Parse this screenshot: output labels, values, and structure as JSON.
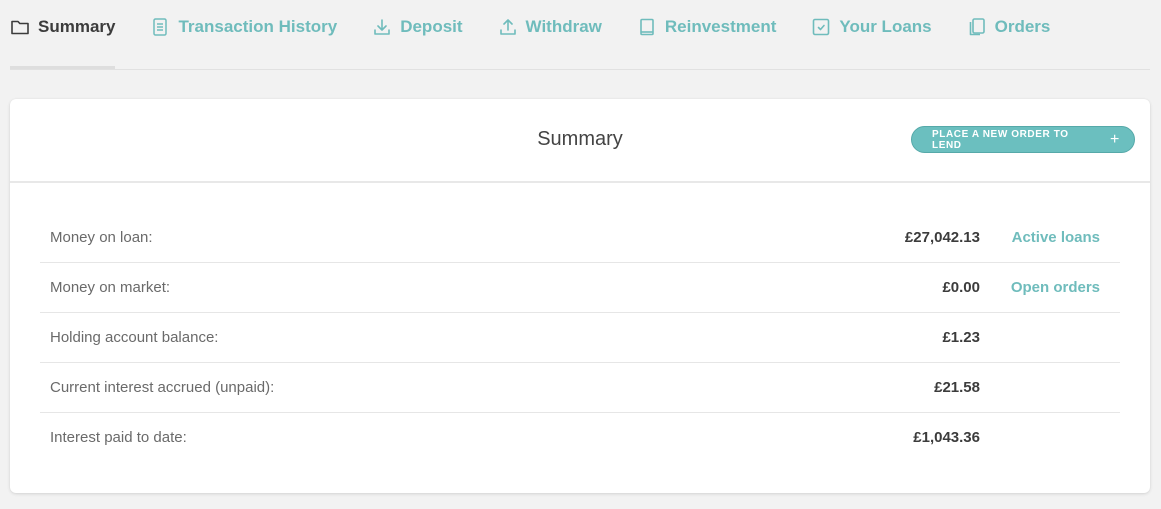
{
  "tabs": [
    {
      "label": "Summary",
      "icon": "folder-icon",
      "active": true
    },
    {
      "label": "Transaction History",
      "icon": "document-icon",
      "active": false
    },
    {
      "label": "Deposit",
      "icon": "download-icon",
      "active": false
    },
    {
      "label": "Withdraw",
      "icon": "upload-icon",
      "active": false
    },
    {
      "label": "Reinvestment",
      "icon": "book-icon",
      "active": false
    },
    {
      "label": "Your Loans",
      "icon": "checkbox-icon",
      "active": false
    },
    {
      "label": "Orders",
      "icon": "copy-icon",
      "active": false
    }
  ],
  "card": {
    "title": "Summary",
    "new_order_button": "PLACE A NEW ORDER TO LEND",
    "new_order_icon": "+"
  },
  "rows": [
    {
      "label": "Money on loan:",
      "value": "£27,042.13",
      "link": "Active loans"
    },
    {
      "label": "Money on market:",
      "value": "£0.00",
      "link": "Open orders"
    },
    {
      "label": "Holding account balance:",
      "value": "£1.23",
      "link": null
    },
    {
      "label": "Current interest accrued (unpaid):",
      "value": "£21.58",
      "link": null
    },
    {
      "label": "Interest paid to date:",
      "value": "£1,043.36",
      "link": null
    }
  ],
  "colors": {
    "accent": "#6fbcbc",
    "button": "#6bbfbf",
    "text_dark": "#3c3c3c",
    "text_label": "#6a6a6a",
    "background": "#f2f2f2"
  }
}
